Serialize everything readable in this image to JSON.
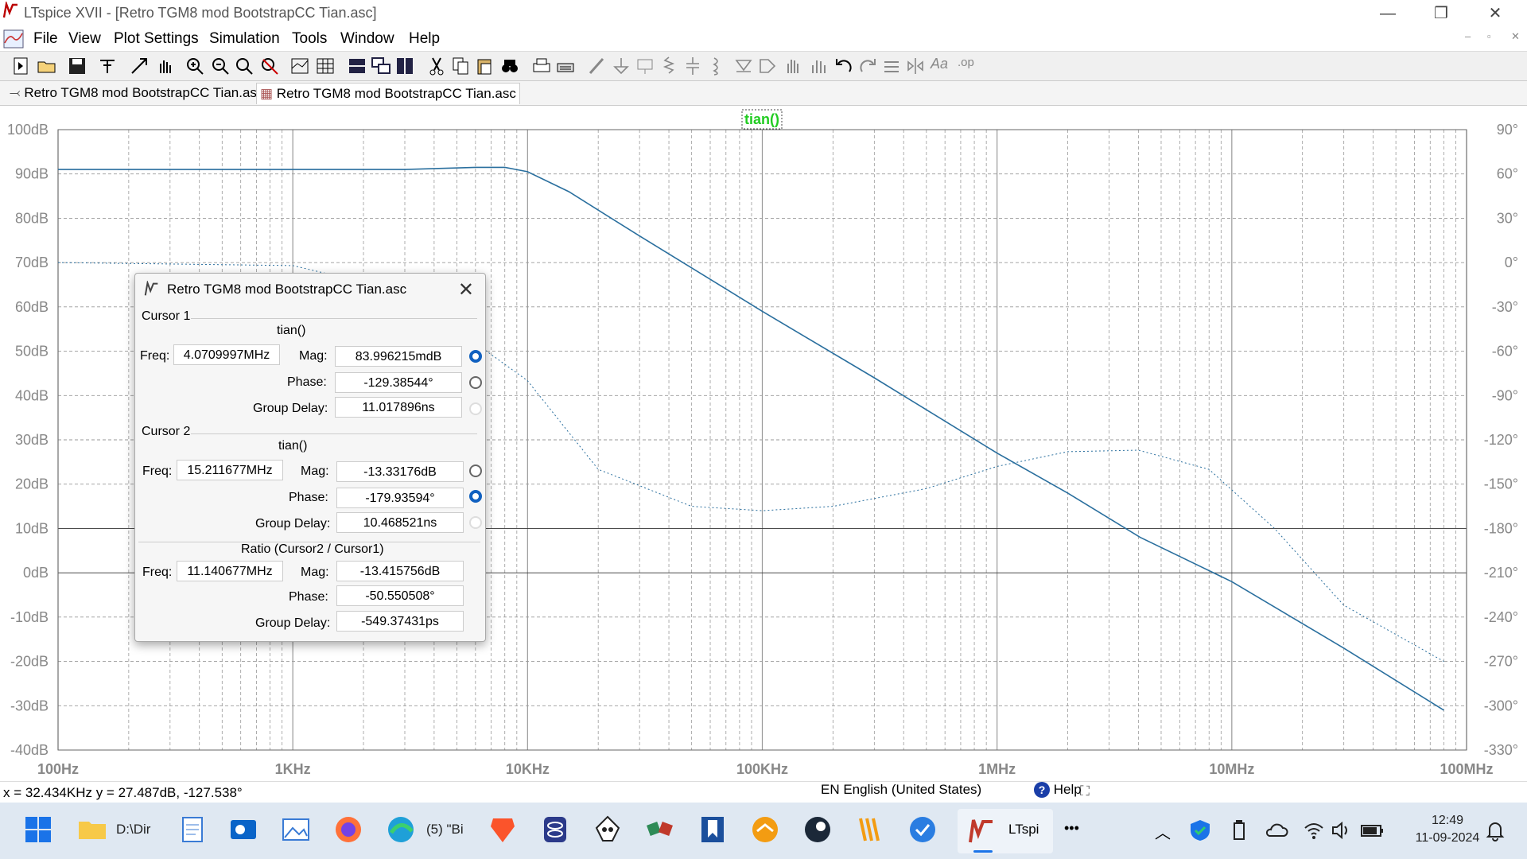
{
  "window": {
    "title": "LTspice XVII - [Retro TGM8 mod BootstrapCC Tian.asc]",
    "minimize": "—",
    "maximize": "❐",
    "close": "✕"
  },
  "menu": {
    "items": [
      "File",
      "View",
      "Plot Settings",
      "Simulation",
      "Tools",
      "Window",
      "Help"
    ],
    "mdi": [
      "–",
      "▫",
      "✕"
    ]
  },
  "tabs": [
    {
      "label": "Retro TGM8 mod BootstrapCC Tian.asc",
      "active": false
    },
    {
      "label": "Retro TGM8 mod BootstrapCC Tian.asc",
      "active": true
    }
  ],
  "plot": {
    "trace_label": "tian()",
    "left_axis": [
      "100dB",
      "90dB",
      "80dB",
      "70dB",
      "60dB",
      "50dB",
      "40dB",
      "30dB",
      "20dB",
      "10dB",
      "0dB",
      "-10dB",
      "-20dB",
      "-30dB",
      "-40dB"
    ],
    "right_axis": [
      "90°",
      "60°",
      "30°",
      "0°",
      "-30°",
      "-60°",
      "-90°",
      "-120°",
      "-150°",
      "-180°",
      "-210°",
      "-240°",
      "-270°",
      "-300°",
      "-330°"
    ],
    "x_axis": [
      "100Hz",
      "1KHz",
      "10KHz",
      "100KHz",
      "1MHz",
      "10MHz",
      "100MHz"
    ],
    "colors": {
      "trace": "#2a6f9e",
      "grid": "#999999",
      "label_green": "#22cc22"
    }
  },
  "chart_data": {
    "type": "line",
    "title": "",
    "xlabel": "",
    "ylabel": "",
    "x_scale": "log",
    "xlim": [
      100,
      100000000
    ],
    "ylim": [
      -40,
      100
    ],
    "y2lim": [
      -330,
      90
    ],
    "series": [
      {
        "name": "tian()",
        "style": "solid magnitude (left axis, dB)",
        "x": [
          100,
          1000,
          3000,
          6000,
          8000,
          10000,
          15000,
          30000,
          100000,
          300000,
          1000000,
          2000000,
          4070000,
          10000000,
          30000000,
          80000000
        ],
        "y": [
          91,
          91,
          91,
          91.5,
          91.5,
          90.5,
          86,
          76,
          59,
          44,
          27,
          18,
          8,
          -2,
          -17,
          -31
        ]
      },
      {
        "name": "tian()",
        "style": "dotted phase (right axis, degrees)",
        "x": [
          100,
          1000,
          3000,
          10000,
          20000,
          50000,
          100000,
          200000,
          500000,
          1000000,
          2000000,
          4000000,
          8000000,
          15200000,
          30000000,
          80000000
        ],
        "y": [
          0,
          -2,
          -20,
          -80,
          -140,
          -165,
          -168,
          -165,
          -153,
          -138,
          -128,
          -127,
          -140,
          -180,
          -232,
          -270
        ]
      }
    ]
  },
  "dialog": {
    "title": "Retro TGM8 mod BootstrapCC Tian.asc",
    "close": "✕",
    "cursor1": {
      "group": "Cursor 1",
      "trace": "tian()",
      "freq_label": "Freq:",
      "freq": "4.0709997MHz",
      "mag_label": "Mag:",
      "mag": "83.996215mdB",
      "phase_label": "Phase:",
      "phase": "-129.38544°",
      "gd_label": "Group Delay:",
      "gd": "11.017896ns"
    },
    "cursor2": {
      "group": "Cursor 2",
      "trace": "tian()",
      "freq_label": "Freq:",
      "freq": "15.211677MHz",
      "mag_label": "Mag:",
      "mag": "-13.33176dB",
      "phase_label": "Phase:",
      "phase": "-179.93594°",
      "gd_label": "Group Delay:",
      "gd": "10.468521ns"
    },
    "ratio": {
      "group": "Ratio (Cursor2 / Cursor1)",
      "freq_label": "Freq:",
      "freq": "11.140677MHz",
      "mag_label": "Mag:",
      "mag": "-13.415756dB",
      "phase_label": "Phase:",
      "phase": "-50.550508°",
      "gd_label": "Group Delay:",
      "gd": "-549.37431ps"
    }
  },
  "status": {
    "coords": "x = 32.434KHz     y = 27.487dB, -127.538°",
    "language": "EN English (United States)",
    "help": "Help"
  },
  "taskbar": {
    "explorer_label": "D:\\Dir",
    "browser_label": "(5) \"Bi",
    "ltspice_label": "LTspi",
    "more": "•••",
    "time": "12:49",
    "date": "11-09-2024"
  }
}
